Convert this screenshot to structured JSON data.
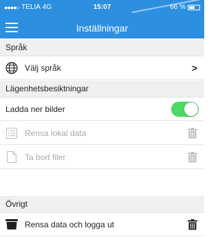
{
  "status_bar": {
    "carrier": "TELIA",
    "network": "4G",
    "time": "15:07",
    "battery_text": "66 %"
  },
  "toolbar": {
    "title": "Inställningar"
  },
  "sections": {
    "language": {
      "header": "Språk",
      "choose_language": "Välj språk"
    },
    "inspections": {
      "header": "Lägenhetsbesiktningar",
      "download_images": "Ladda ner bilder",
      "download_images_enabled": true,
      "clear_local_data": "Rensa lokal data",
      "delete_files": "Ta bort filer"
    },
    "other": {
      "header": "Övrigt",
      "clear_and_logout": "Rensa data och logga ut"
    }
  },
  "colors": {
    "accent": "#2c8fe0",
    "toggle_on": "#4cd964",
    "disabled_text": "#a8a8a8"
  },
  "icons": {
    "menu": "hamburger-icon",
    "language": "globe-icon",
    "chevron": "chevron-right-icon",
    "clear_local": "list-icon",
    "delete_files": "document-icon",
    "trash": "trash-icon"
  }
}
